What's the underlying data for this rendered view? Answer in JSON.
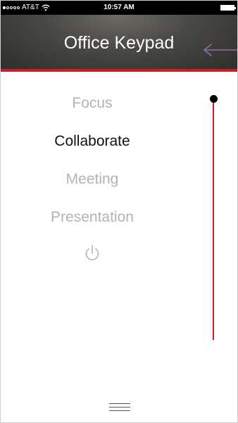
{
  "status_bar": {
    "carrier": "AT&T",
    "time": "10:57 AM",
    "signal_icon": "signal-dots-icon",
    "wifi_icon": "wifi-icon",
    "battery_icon": "battery-icon"
  },
  "header": {
    "title": "Office Keypad",
    "back_icon": "arrow-left-icon"
  },
  "modes": {
    "items": [
      {
        "label": "Focus"
      },
      {
        "label": "Collaborate"
      },
      {
        "label": "Meeting"
      },
      {
        "label": "Presentation"
      }
    ],
    "power_icon": "power-icon"
  },
  "slider": {
    "level": 1.0
  },
  "footer": {
    "menu_icon": "hamburger-menu-icon"
  },
  "colors": {
    "accent": "#c8202a",
    "back_arrow": "#8a6fb3",
    "inactive_text": "#b3b3b3",
    "active_text": "#111111"
  }
}
